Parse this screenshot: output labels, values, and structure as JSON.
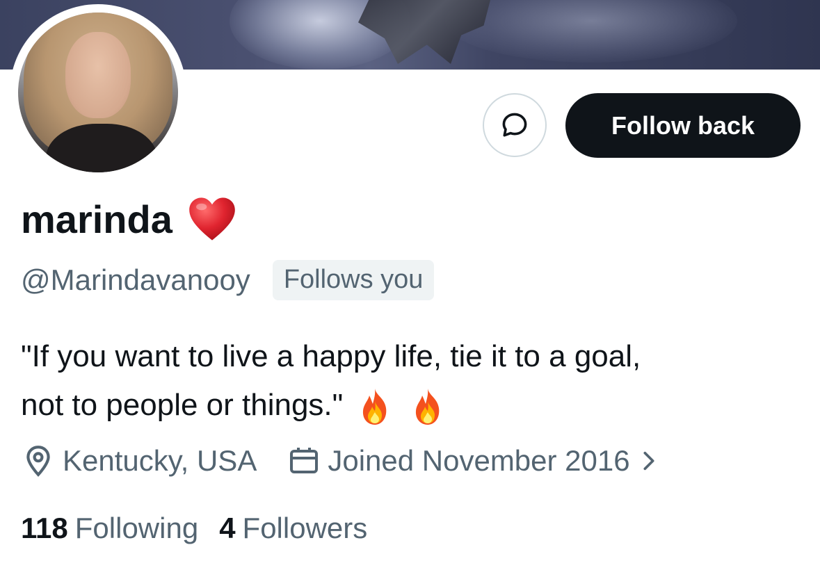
{
  "profile": {
    "display_name": "marinda",
    "handle": "@Marindavanooy",
    "follows_you_badge": "Follows you",
    "bio_line1": "\"If you want to live a happy life, tie it to a goal,",
    "bio_line2": "not to people or things.\"",
    "location": "Kentucky, USA",
    "joined": "Joined November 2016"
  },
  "actions": {
    "follow_back_label": "Follow back"
  },
  "stats": {
    "following_count": "118",
    "following_label": "Following",
    "followers_count": "4",
    "followers_label": "Followers"
  },
  "icons": {
    "name_emoji": "heart-emoji",
    "bio_emojis": [
      "fire-emoji",
      "fire-emoji"
    ],
    "dm": "message-bubble-icon",
    "location": "location-pin-icon",
    "calendar": "calendar-icon",
    "chevron": "chevron-right-icon"
  },
  "colors": {
    "primary_text": "#0f1419",
    "secondary_text": "#536471",
    "button_bg": "#0f1419",
    "badge_bg": "#eff3f4",
    "border": "#cfd9de",
    "heart": "#e0242f"
  }
}
